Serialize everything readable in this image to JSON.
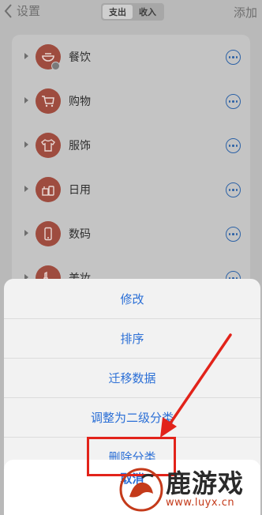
{
  "nav": {
    "back_label": "设置",
    "segments": [
      "支出",
      "收入"
    ],
    "active_segment": "支出",
    "add_label": "添加"
  },
  "categories": [
    {
      "label": "餐饮",
      "icon": "bowl-icon"
    },
    {
      "label": "购物",
      "icon": "cart-icon"
    },
    {
      "label": "服饰",
      "icon": "shirt-icon"
    },
    {
      "label": "日用",
      "icon": "daily-goods-icon"
    },
    {
      "label": "数码",
      "icon": "phone-icon"
    },
    {
      "label": "美妆",
      "icon": "makeup-icon"
    }
  ],
  "sheet": {
    "actions": [
      "修改",
      "排序",
      "迁移数据",
      "调整为二级分类",
      "删除分类"
    ],
    "cancel": "取消"
  },
  "watermark": {
    "brand": "鹿游戏",
    "url": "www.luyx.cn"
  },
  "colors": {
    "accent": "#2b6fd6",
    "highlight": "#e2231a",
    "category_icon": "#9e4c3f"
  }
}
